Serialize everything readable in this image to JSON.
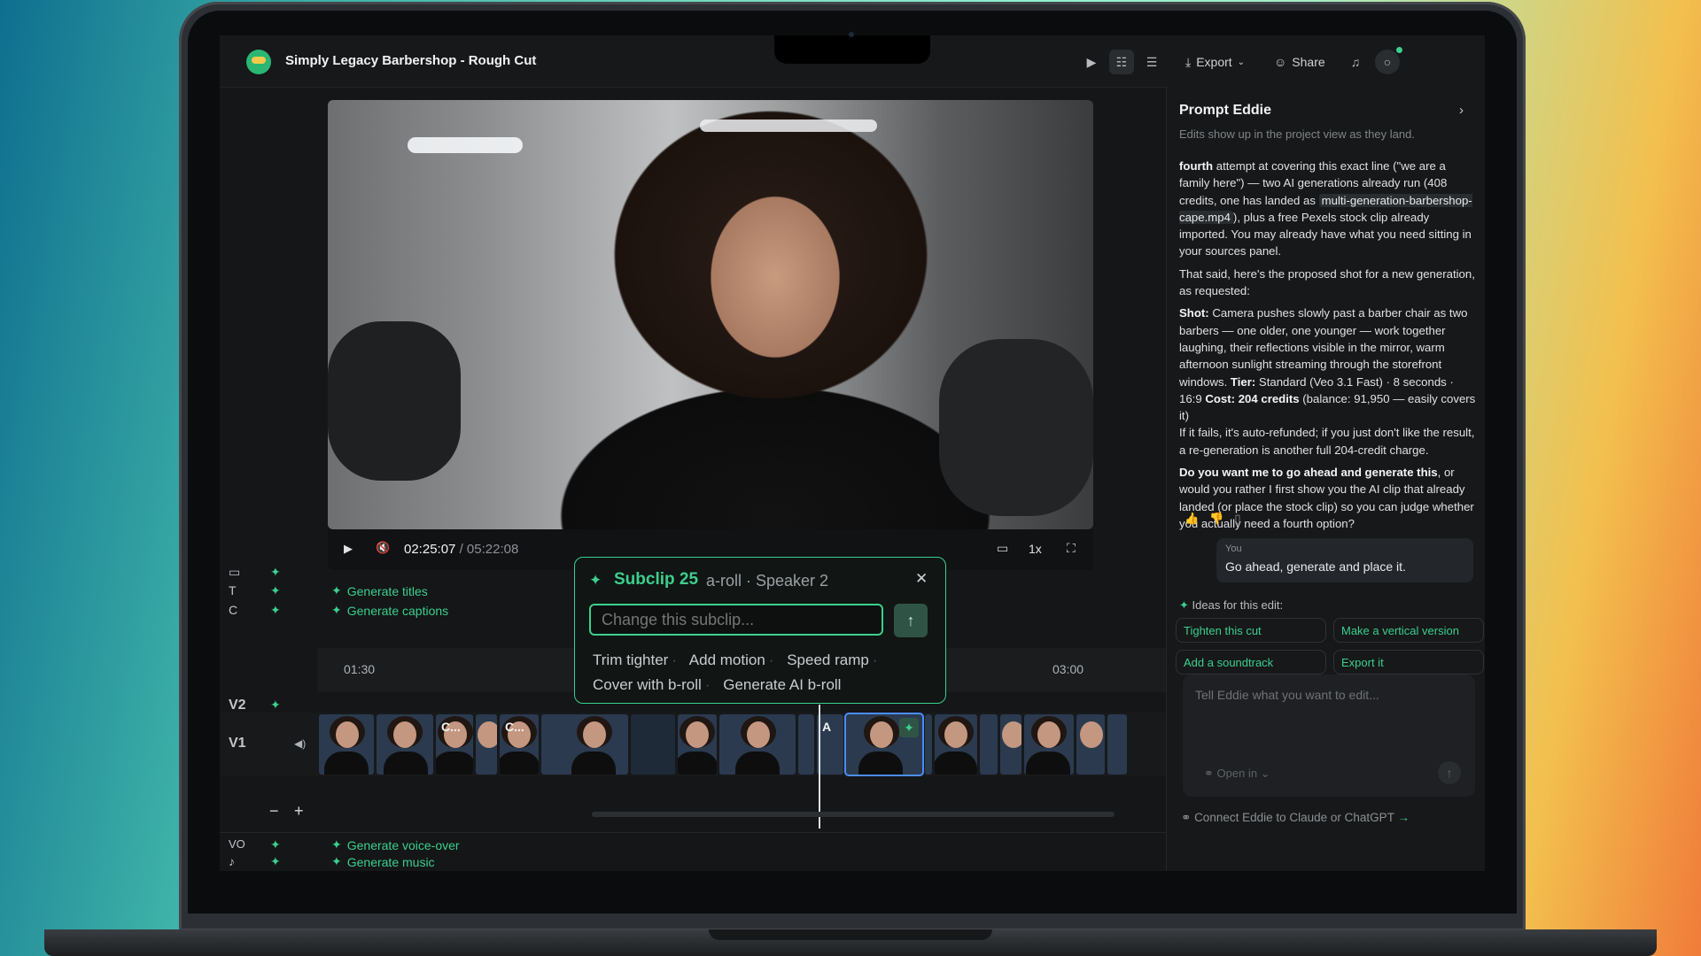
{
  "project_title": "Simply Legacy Barbershop - Rough Cut",
  "toolbar": {
    "export_label": "Export",
    "share_label": "Share"
  },
  "player": {
    "current_time": "02:25:07",
    "separator": "/",
    "duration": "05:22:08",
    "speed": "1x"
  },
  "timeline": {
    "tracks": {
      "titles": "T",
      "captions": "C",
      "v2": "V2",
      "v1": "V1",
      "voiceover": "VO"
    },
    "generate_titles": "Generate titles",
    "generate_captions": "Generate captions",
    "generate_voiceover": "Generate voice-over",
    "generate_music": "Generate music",
    "ruler": [
      "01:30",
      "03:00"
    ],
    "clip_labels": [
      "C...",
      "C...",
      "A"
    ]
  },
  "subclip_popover": {
    "title": "Subclip 25",
    "subtitle": "a-roll · Speaker 2",
    "input_placeholder": "Change this subclip...",
    "suggestions": [
      "Trim tighter",
      "Add motion",
      "Speed ramp",
      "Cover with b-roll",
      "Generate AI b-roll"
    ]
  },
  "assistant": {
    "title": "Prompt Eddie",
    "subtitle": "Edits show up in the project view as they land.",
    "message": {
      "p1_lead": "fourth",
      "p1_a": " attempt at covering this exact line (\"we are a family here\") — two AI generations already run (408 credits, one has landed as ",
      "p1_file": "multi-generation-barbershop-cape.mp4",
      "p1_b": "), plus a free Pexels stock clip already imported. You may already have what you need sitting in your sources panel.",
      "p2": "That said, here's the proposed shot for a new generation, as requested:",
      "shot_label": "Shot:",
      "shot_text": " Camera pushes slowly past a barber chair as two barbers — one older, one younger — work together laughing, their reflections visible in the mirror, warm afternoon sunlight streaming through the storefront windows. ",
      "tier_label": "Tier:",
      "tier_text": " Standard (Veo 3.1 Fast) · 8 seconds · 16:9 ",
      "cost_label": "Cost: 204 credits",
      "cost_text": " (balance: 91,950 — easily covers it)",
      "p4": "If it fails, it's auto-refunded; if you just don't like the result, a re-generation is another full 204-credit charge.",
      "q_bold": "Do you want me to go ahead and generate this",
      "q_text": ", or would you rather I first show you the AI clip that already landed (or place the stock clip) so you can judge whether you actually need a fourth option?"
    },
    "user_label": "You",
    "user_message": "Go ahead, generate and place it.",
    "ideas_label": "Ideas for this edit:",
    "ideas": [
      "Tighten this cut",
      "Make a vertical version",
      "Add a soundtrack",
      "Export it"
    ],
    "composer_placeholder": "Tell Eddie what you want to edit...",
    "open_in": "Open in",
    "connect": "Connect Eddie to Claude or ChatGPT"
  },
  "colors": {
    "accent": "#3ccf8e",
    "selection": "#4c8dff",
    "background": "#141618"
  }
}
